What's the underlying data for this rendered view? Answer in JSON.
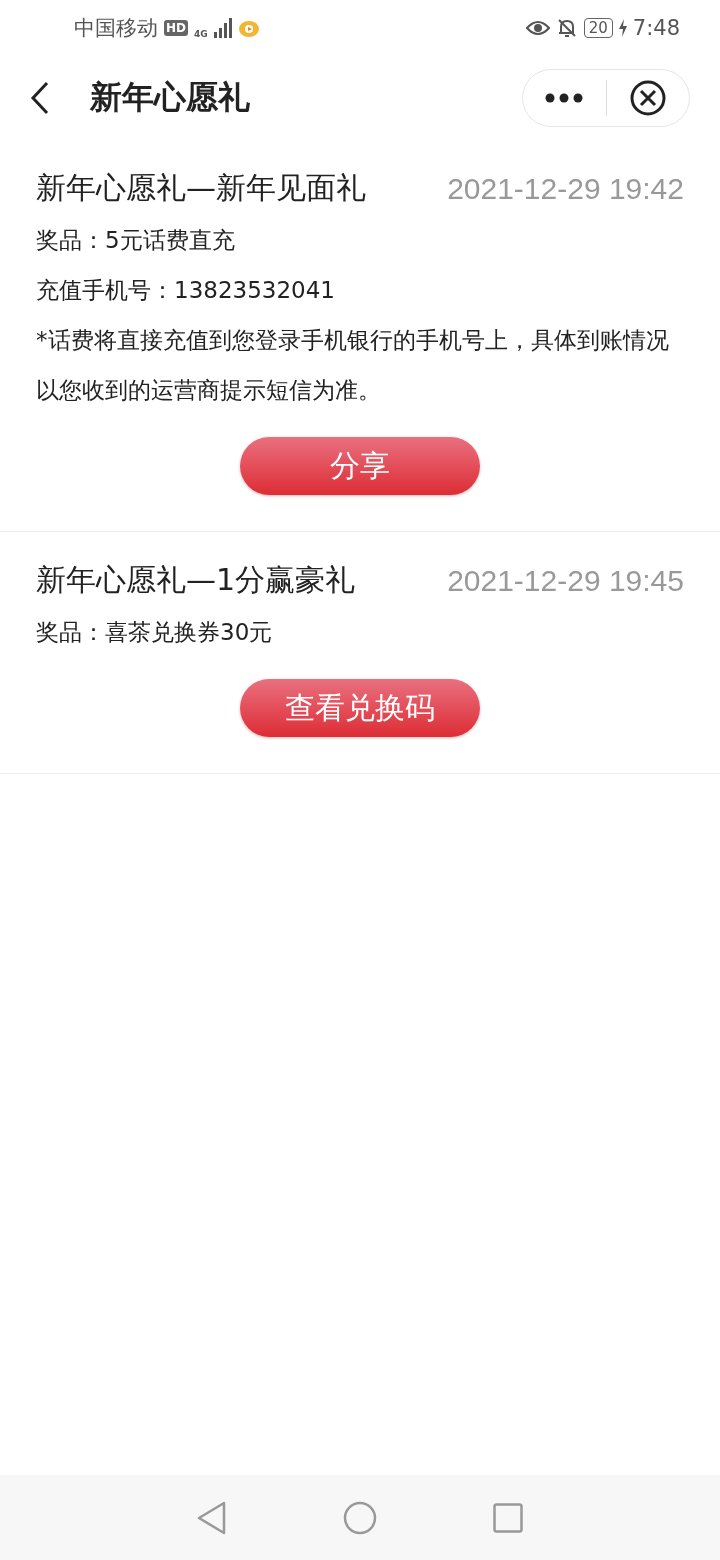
{
  "status_bar": {
    "carrier": "中国移动",
    "hd_badge": "HD",
    "network": "4G",
    "battery": "20",
    "time": "7:48"
  },
  "nav_bar": {
    "title": "新年心愿礼"
  },
  "gifts": [
    {
      "title": "新年心愿礼—新年见面礼",
      "time": "2021-12-29 19:42",
      "lines": [
        "奖品：5元话费直充",
        "充值手机号：13823532041",
        "*话费将直接充值到您登录手机银行的手机号上，具体到账情况以您收到的运营商提示短信为准。"
      ],
      "button": "分享"
    },
    {
      "title": "新年心愿礼—1分赢豪礼",
      "time": "2021-12-29 19:45",
      "lines": [
        "奖品：喜茶兑换券30元"
      ],
      "button": "查看兑换码"
    }
  ]
}
